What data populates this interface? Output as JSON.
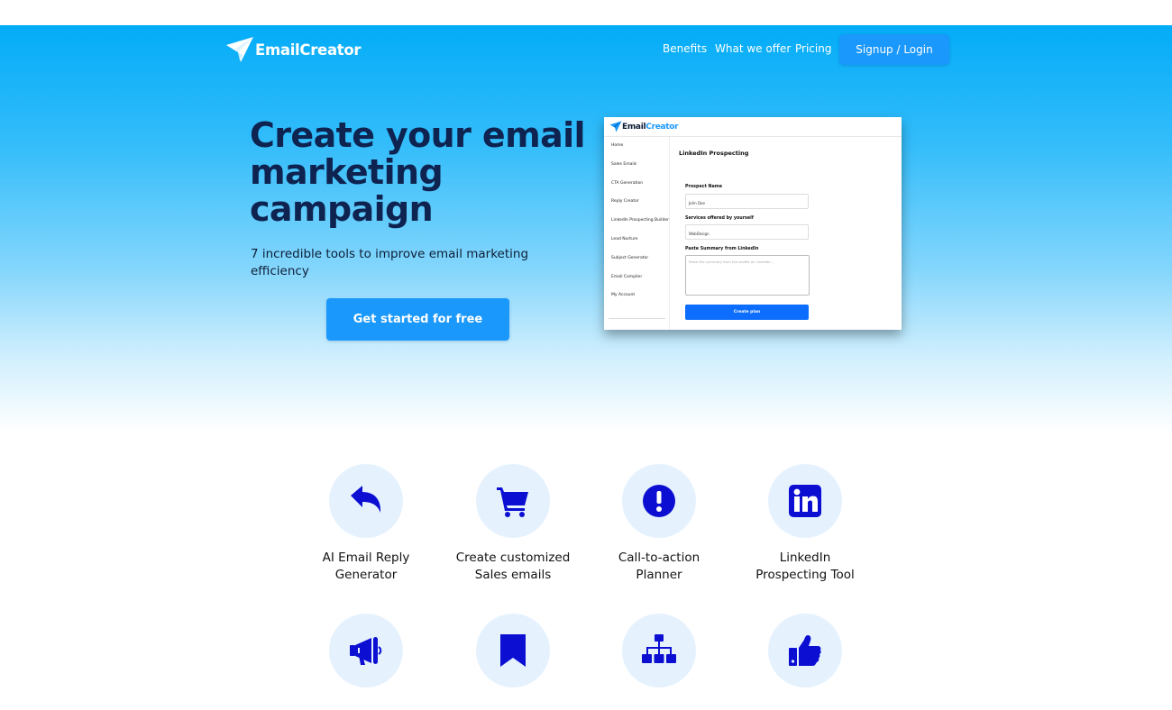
{
  "brand": {
    "name": "EmailCreator",
    "accent": "#03acf8",
    "button": "#1a98fb",
    "icon_color": "#0c0fd2"
  },
  "nav": {
    "links": [
      {
        "label": "Benefits"
      },
      {
        "label": "What we offer"
      },
      {
        "label": "Pricing"
      }
    ],
    "signup_label": "Signup / Login"
  },
  "hero": {
    "headline": "Create your email marketing campaign",
    "subline": "7 incredible tools to improve email marketing efficiency",
    "cta_label": "Get started for free"
  },
  "preview": {
    "logo_left": "Email",
    "logo_right": "Creator",
    "sidebar": [
      "Home",
      "Sales Emails",
      "CTA Generation",
      "Reply Creator",
      "LinkedIn Prospecting Builder",
      "Lead Nurture",
      "Subject Generator",
      "Email Compiler",
      "My Account"
    ],
    "title": "LinkedIn Prospecting",
    "field1_label": "Prospect Name",
    "field1_value": "John Doe",
    "field2_label": "Services offered by yourself",
    "field2_value": "WebDesign",
    "field3_label": "Paste Summary from LinkedIn",
    "field3_placeholder": "Paste the summary from the profile on LinkedIn...",
    "button_label": "Create plan"
  },
  "features": [
    {
      "icon": "reply-icon",
      "line1": "AI Email Reply",
      "line2": "Generator"
    },
    {
      "icon": "cart-icon",
      "line1": "Create customized",
      "line2": "Sales emails"
    },
    {
      "icon": "exclamation-icon",
      "line1": "Call-to-action",
      "line2": "Planner"
    },
    {
      "icon": "linkedin-icon",
      "line1": "LinkedIn",
      "line2": "Prospecting Tool"
    },
    {
      "icon": "megaphone-icon",
      "line1": "",
      "line2": ""
    },
    {
      "icon": "bookmark-icon",
      "line1": "",
      "line2": ""
    },
    {
      "icon": "sitemap-icon",
      "line1": "",
      "line2": ""
    },
    {
      "icon": "thumbs-up-icon",
      "line1": "",
      "line2": ""
    }
  ]
}
